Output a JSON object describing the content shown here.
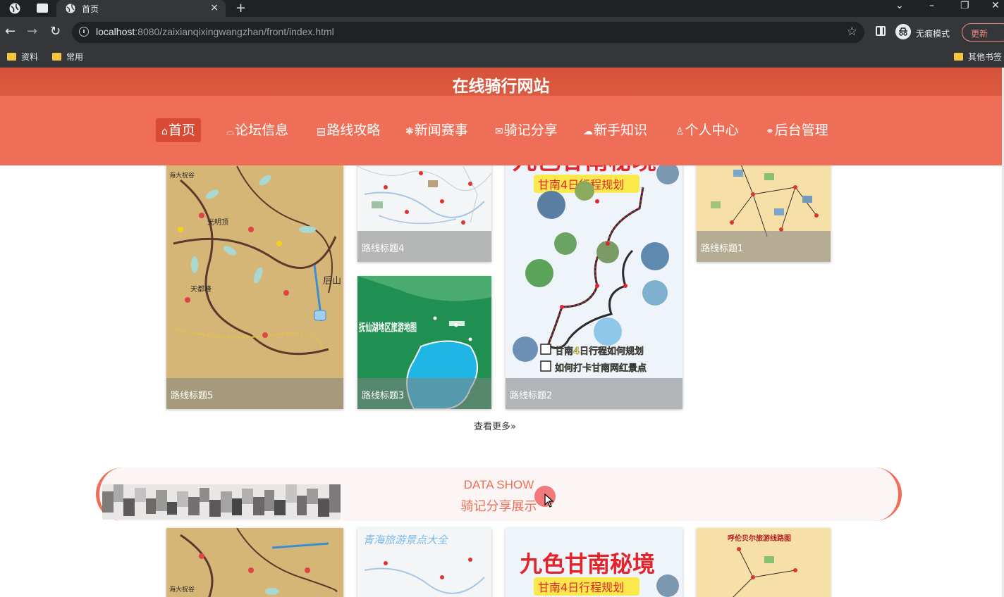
{
  "browser": {
    "tab_title": "首页",
    "tab_close": "×",
    "new_tab": "+",
    "url_host": "localhost",
    "url_rest": ":8080/zaixianqixingwangzhan/front/index.html",
    "incognito_label": "无痕模式",
    "update_label": "更新",
    "bookmarks": [
      "资料",
      "常用"
    ],
    "other_bookmarks": "其他书签"
  },
  "site": {
    "title": "在线骑行网站",
    "nav": [
      {
        "icon": "⌂",
        "label": "首页"
      },
      {
        "icon": "⌓",
        "label": "论坛信息"
      },
      {
        "icon": "▤",
        "label": "路线攻略"
      },
      {
        "icon": "❃",
        "label": "新闻赛事"
      },
      {
        "icon": "✉",
        "label": "骑记分享"
      },
      {
        "icon": "☁",
        "label": "新手知识"
      },
      {
        "icon": "♙",
        "label": "个人中心"
      },
      {
        "icon": "⚭",
        "label": "后台管理"
      }
    ]
  },
  "routes": {
    "cards": [
      {
        "caption": "路线标题5"
      },
      {
        "caption": "路线标题4"
      },
      {
        "caption": "路线标题3"
      },
      {
        "caption": "路线标题2"
      },
      {
        "caption": "路线标题1"
      }
    ],
    "more": "查看更多»"
  },
  "map_texts": {
    "gannan_title": "九色甘南秘境",
    "gannan_sub": "甘南4日行程规划",
    "gannan_c1": "甘南4日行程如何规划",
    "gannan_c2": "如何打卡甘南网红景点",
    "fuxian": "抚仙湖地区旅游地图",
    "qinghai": "青海旅游景点大全",
    "hulun": "呼伦贝尔旅游线路图",
    "huangshan": [
      "光明顶",
      "天都峰",
      "后山",
      "海大祝谷"
    ]
  },
  "share_section": {
    "title_en": "DATA SHOW",
    "title_zh": "骑记分享展示"
  },
  "colors": {
    "header_dark": "#d6523a",
    "header_nav": "#ef6e57",
    "nav_active": "#d84a34",
    "accent": "#ef6e57"
  }
}
